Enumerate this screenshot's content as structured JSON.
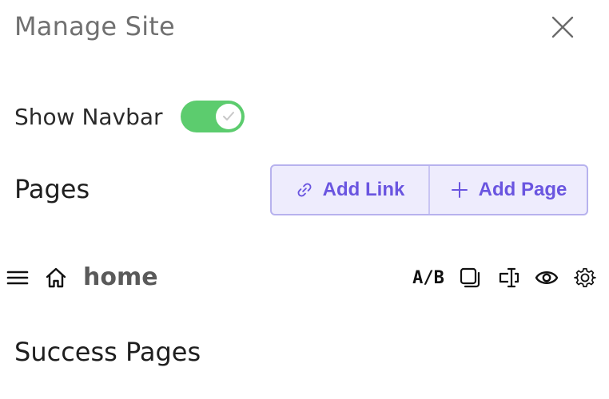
{
  "header": {
    "title": "Manage Site"
  },
  "navbar": {
    "label": "Show Navbar",
    "enabled": true
  },
  "pages_section": {
    "heading": "Pages",
    "add_link_label": "Add Link",
    "add_page_label": "Add Page"
  },
  "pages": [
    {
      "name": "home",
      "is_home": true,
      "ab_label": "A/B"
    }
  ],
  "success_section": {
    "heading": "Success Pages"
  },
  "colors": {
    "toggle_on": "#5ccc6e",
    "accent": "#6a55e0",
    "accent_bg": "#eeecfd"
  },
  "icons": {
    "close": "close-icon",
    "link": "link-icon",
    "plus": "plus-icon",
    "drag": "hamburger-icon",
    "home": "home-icon",
    "duplicate": "duplicate-icon",
    "rename": "text-cursor-icon",
    "preview": "eye-icon",
    "settings": "gear-icon"
  }
}
